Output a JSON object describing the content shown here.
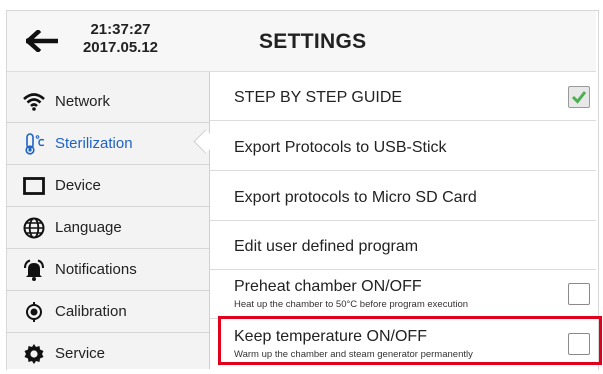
{
  "header": {
    "time": "21:37:27",
    "date": "2017.05.12",
    "title": "SETTINGS",
    "back_icon": "arrow-left-icon"
  },
  "sidebar": {
    "items": [
      {
        "label": "Network",
        "icon": "wifi-icon",
        "active": false
      },
      {
        "label": "Sterilization",
        "icon": "thermometer-icon",
        "active": true
      },
      {
        "label": "Device",
        "icon": "device-icon",
        "active": false
      },
      {
        "label": "Language",
        "icon": "globe-icon",
        "active": false
      },
      {
        "label": "Notifications",
        "icon": "bell-icon",
        "active": false
      },
      {
        "label": "Calibration",
        "icon": "calibration-icon",
        "active": false
      },
      {
        "label": "Service",
        "icon": "gear-icon",
        "active": false
      }
    ]
  },
  "settings": {
    "rows": [
      {
        "title": "STEP BY STEP GUIDE",
        "subtitle": "",
        "checkbox": true,
        "checked": true
      },
      {
        "title": "Export Protocols to USB-Stick",
        "subtitle": "",
        "checkbox": false,
        "checked": false
      },
      {
        "title": "Export protocols to Micro SD Card",
        "subtitle": "",
        "checkbox": false,
        "checked": false
      },
      {
        "title": "Edit user defined program",
        "subtitle": "",
        "checkbox": false,
        "checked": false
      },
      {
        "title": "Preheat chamber ON/OFF",
        "subtitle": "Heat up the chamber to 50°C before program execution",
        "checkbox": true,
        "checked": false
      },
      {
        "title": "Keep temperature ON/OFF",
        "subtitle": "Warm up the chamber and steam generator permanently",
        "checkbox": true,
        "checked": false,
        "highlighted": true
      }
    ]
  },
  "colors": {
    "accent": "#1e63c4",
    "highlight": "#e0001b",
    "check": "#4caf50"
  }
}
